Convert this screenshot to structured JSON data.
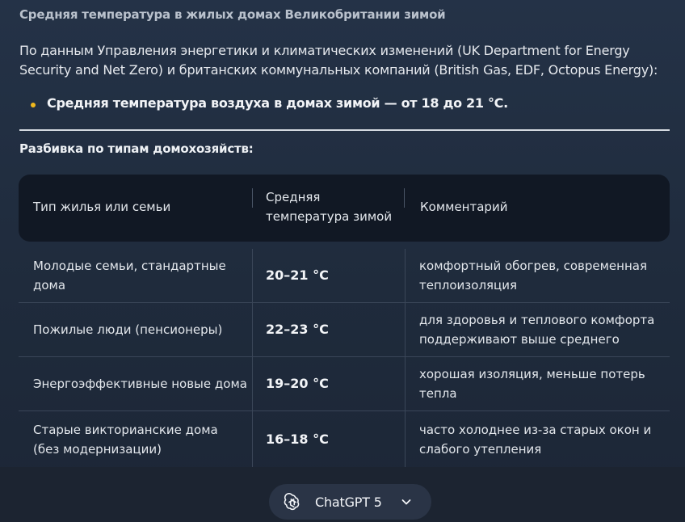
{
  "message": {
    "heading": "Средняя температура в жилых домах Великобритании зимой",
    "intro": "По данным Управления энергетики и климатических изменений (UK Department for Energy Security and Net Zero) и британских коммунальных компаний (British Gas, EDF, Octopus Energy):",
    "bullet": "Средняя температура воздуха в домах зимой — от 18 до 21 °C.",
    "subheading": "Разбивка по типам домохозяйств:"
  },
  "table": {
    "headers": [
      "Тип жилья или семьи",
      "Средняя температура зимой",
      "Комментарий"
    ],
    "rows": [
      [
        "Молодые семьи, стандартные дома",
        "20–21 °C",
        "комфортный обогрев, современная теплоизоляция"
      ],
      [
        "Пожилые люди (пенсионеры)",
        "22–23 °C",
        "для здоровья и теплового комфорта поддерживают выше среднего"
      ],
      [
        "Энергоэффективные новые дома",
        "19–20 °C",
        "хорошая изоляция, меньше потерь тепла"
      ],
      [
        "Старые викторианские дома (без модернизации)",
        "16–18 °C",
        "часто холоднее из-за старых окон и слабого утепления"
      ]
    ]
  },
  "footer": {
    "model_label": "ChatGPT 5",
    "logo_icon": "openai-logo-icon",
    "chevron_icon": "chevron-down-icon"
  },
  "colors": {
    "bullet_dot": "#f0b81d",
    "table_header_bg": "#111824",
    "pill_bg": "#2a3446"
  }
}
